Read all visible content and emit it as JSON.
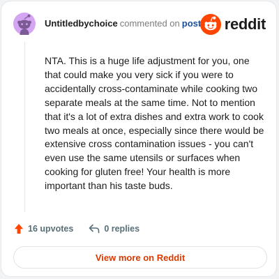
{
  "comment": {
    "author": "Untitledbychoice",
    "action_text": "commented on",
    "post_link_text": "post",
    "body": "NTA. This is a huge life adjustment for you, one that could make you very sick if you were to accidentally cross-contaminate while cooking two separate meals at the same time. Not to mention that it's a lot of extra dishes and extra work to cook two meals at once, especially since there would be extensive cross contamination issues - you can't even use the same utensils or surfaces when cooking for gluten free! Your health is more important than his taste buds.",
    "upvotes_label": "16 upvotes",
    "replies_label": "0 replies"
  },
  "brand": {
    "name": "reddit",
    "icon": "reddit-logo-icon"
  },
  "footer": {
    "view_more_label": "View more on Reddit"
  },
  "icons": {
    "avatar": "snoo-avatar-icon",
    "upvote": "upvote-arrow-icon",
    "reply": "reply-arrow-icon"
  },
  "colors": {
    "reddit_orange": "#ff4500",
    "link_blue": "#1a4f9c",
    "button_text": "#d93a00",
    "avatar_bg": "#d4a5f2",
    "muted_text": "#576f76"
  }
}
